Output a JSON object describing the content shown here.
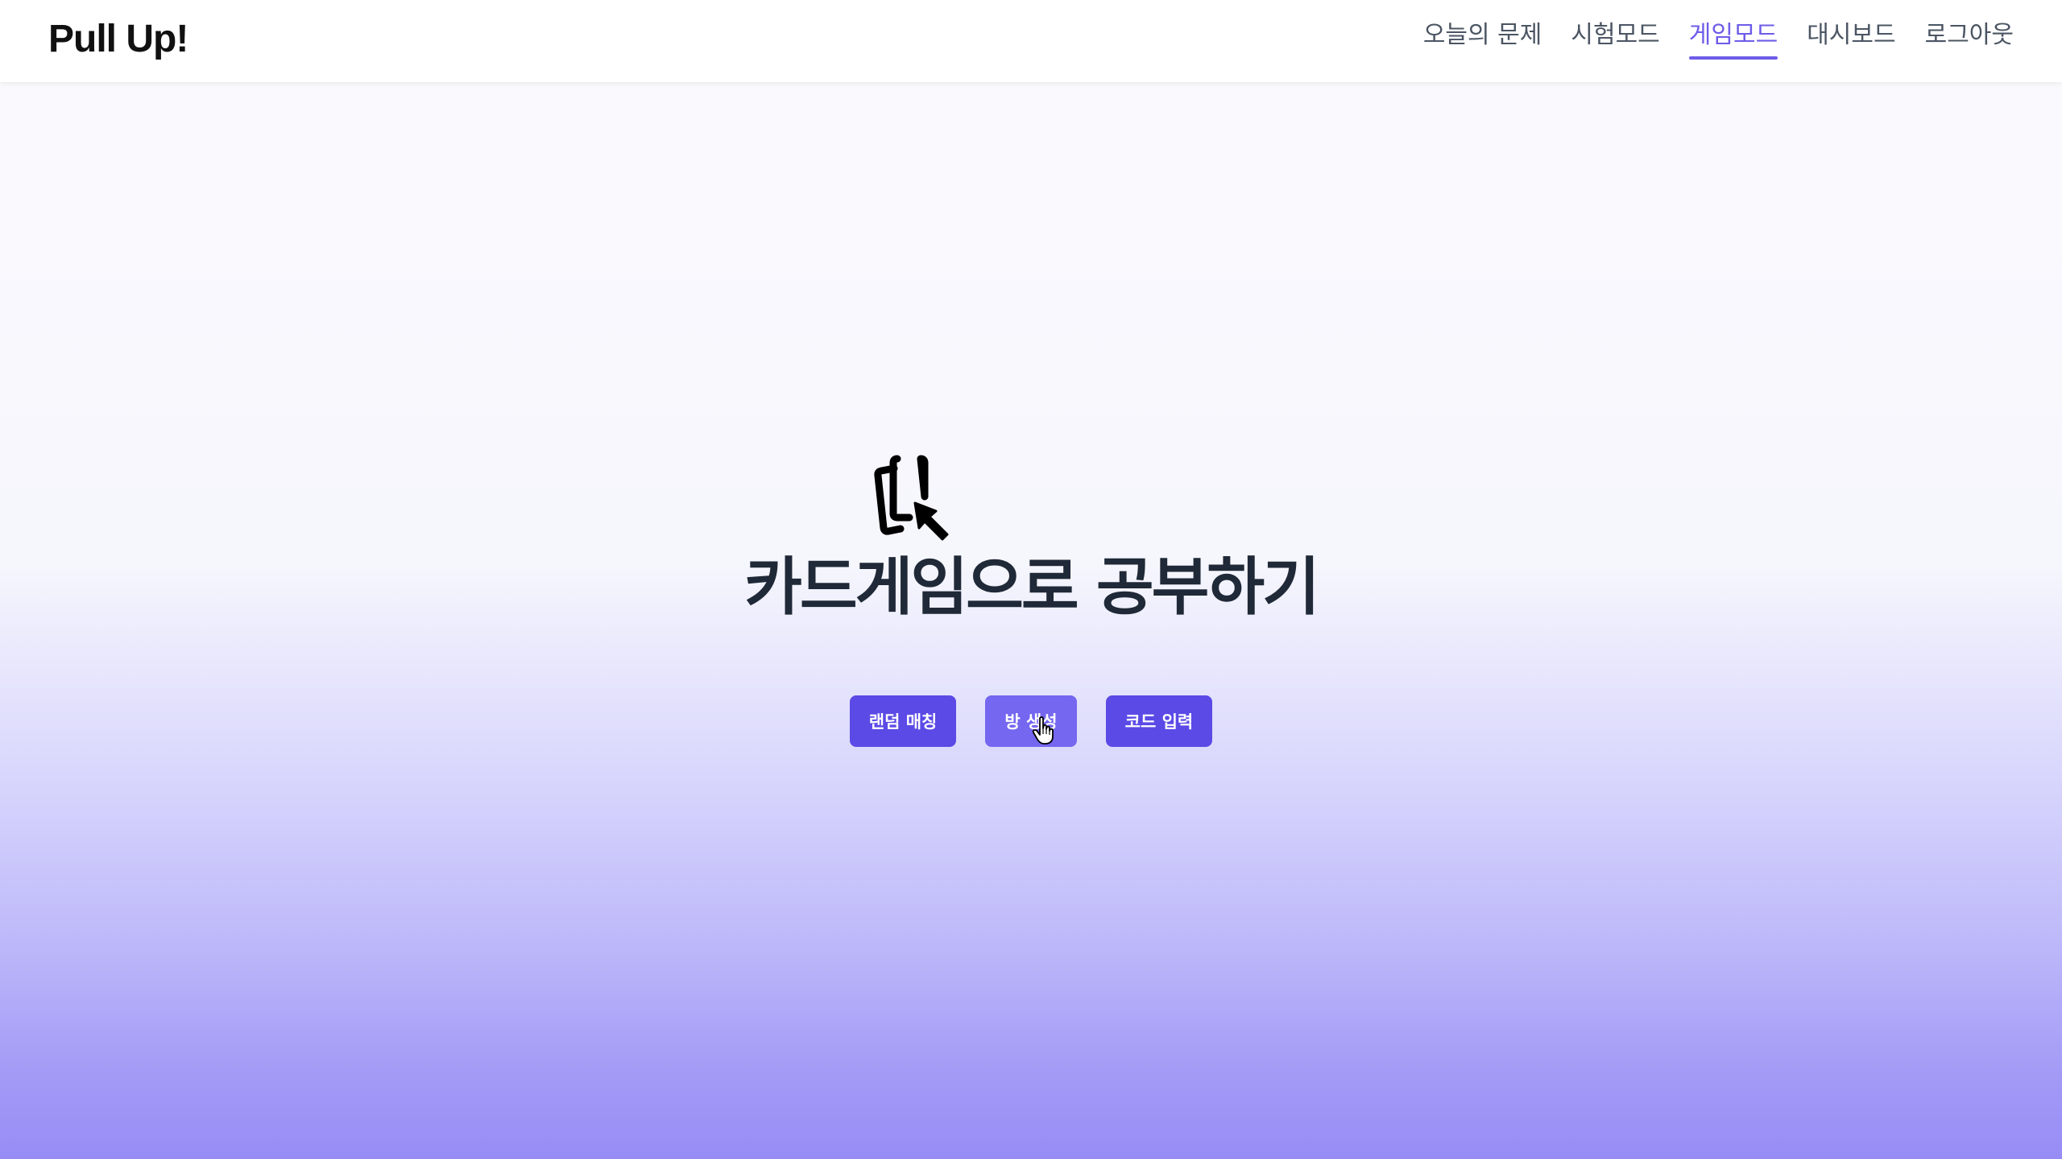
{
  "brand": {
    "logo_text": "Pull Up!"
  },
  "nav": {
    "items": [
      {
        "label": "오늘의 문제",
        "active": false
      },
      {
        "label": "시험모드",
        "active": false
      },
      {
        "label": "게임모드",
        "active": true
      },
      {
        "label": "대시보드",
        "active": false
      },
      {
        "label": "로그아웃",
        "active": false
      }
    ]
  },
  "hero": {
    "icon": "card-pointer-icon",
    "title": "카드게임으로 공부하기",
    "buttons": {
      "random_match": "랜덤 매칭",
      "create_room": "방 생성",
      "enter_code": "코드 입력"
    }
  },
  "colors": {
    "accent": "#5b4ae6",
    "accent_hover": "#7567f0",
    "nav_active": "#6d5ce8",
    "title_text": "#1f2937",
    "gradient_bottom": "#978cf5"
  }
}
